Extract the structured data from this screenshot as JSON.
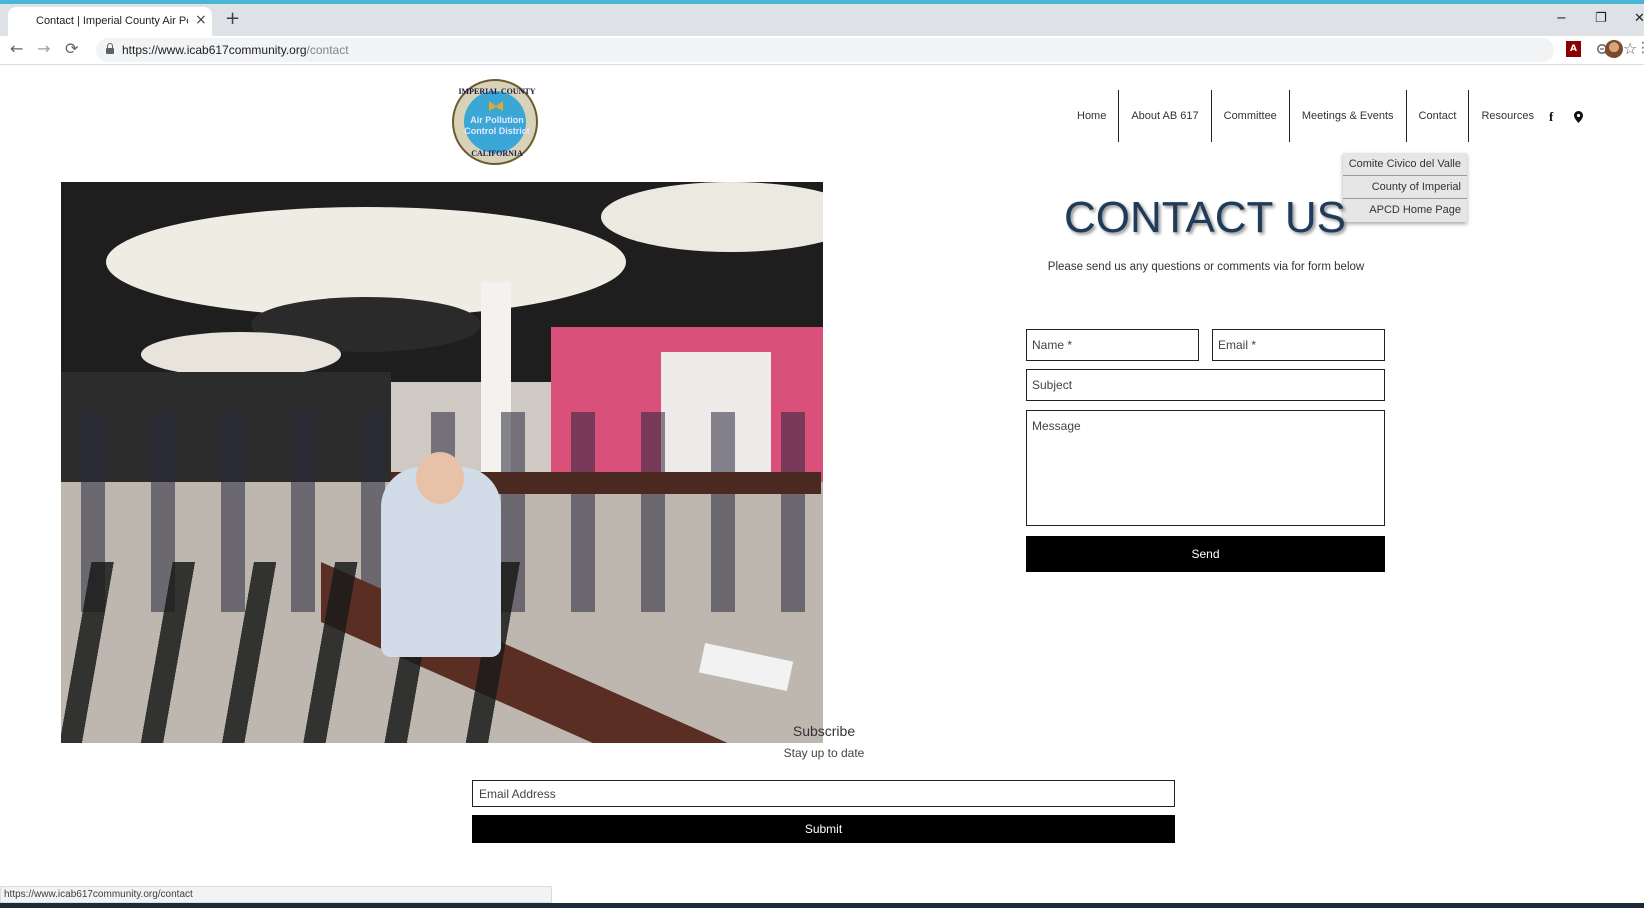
{
  "browser": {
    "tab_title": "Contact | Imperial County Air Pol",
    "tab_close": "×",
    "new_tab": "+",
    "url_host": "https://www.icab617community.org",
    "url_path": "/contact",
    "minimize": "−",
    "restore": "❐",
    "close": "✕",
    "back": "←",
    "forward": "→",
    "reload": "⟳",
    "star": "☆",
    "pdf_label": "A",
    "menu": "⋮",
    "status_url": "https://www.icab617community.org/contact"
  },
  "logo": {
    "top_text": "IMPERIAL COUNTY",
    "mid_text_1": "Air Pollution",
    "mid_text_2": "Control District",
    "bottom_text": "CALIFORNIA"
  },
  "nav": {
    "items": [
      {
        "label": "Home"
      },
      {
        "label": "About AB 617"
      },
      {
        "label": "Committee"
      },
      {
        "label": "Meetings & Events"
      },
      {
        "label": "Contact"
      },
      {
        "label": "Resources"
      }
    ],
    "facebook_glyph": "f"
  },
  "dropdown": {
    "items": [
      {
        "label": "Comite Civico del Valle"
      },
      {
        "label": "County of Imperial"
      },
      {
        "label": "APCD Home Page"
      }
    ]
  },
  "contact": {
    "title": "CONTACT US",
    "subtitle": "Please send us any questions or comments via for form below",
    "name_placeholder": "Name *",
    "email_placeholder": "Email *",
    "subject_placeholder": "Subject",
    "message_placeholder": "Message",
    "send_label": "Send"
  },
  "subscribe": {
    "title": "Subscribe",
    "subtitle": "Stay up to date",
    "email_placeholder": "Email Address",
    "submit_label": "Submit"
  }
}
